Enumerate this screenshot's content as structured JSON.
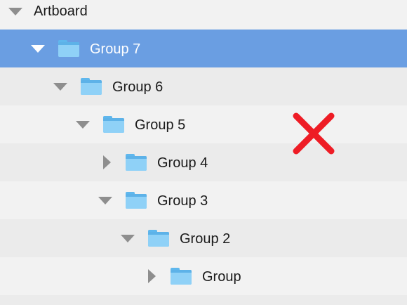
{
  "tree": {
    "artboard": {
      "label": "Artboard",
      "expanded": true
    },
    "groups": [
      {
        "label": "Group 7",
        "expanded": true,
        "selected": true,
        "icon": "folder-icon"
      },
      {
        "label": "Group 6",
        "expanded": true,
        "selected": false,
        "icon": "folder-icon"
      },
      {
        "label": "Group 5",
        "expanded": true,
        "selected": false,
        "icon": "folder-icon"
      },
      {
        "label": "Group 4",
        "expanded": false,
        "selected": false,
        "icon": "folder-icon"
      },
      {
        "label": "Group 3",
        "expanded": true,
        "selected": false,
        "icon": "folder-icon"
      },
      {
        "label": "Group 2",
        "expanded": true,
        "selected": false,
        "icon": "folder-icon"
      },
      {
        "label": "Group",
        "expanded": false,
        "selected": false,
        "icon": "folder-icon"
      }
    ]
  },
  "overlay": {
    "icon": "cross-icon",
    "color": "#ee1c25"
  },
  "colors": {
    "selection": "#6a9ee2",
    "row_light": "#f2f2f2",
    "row_dark": "#ebebeb",
    "folder": "#7cc7f4",
    "disclosure": "#8e8e8e"
  }
}
